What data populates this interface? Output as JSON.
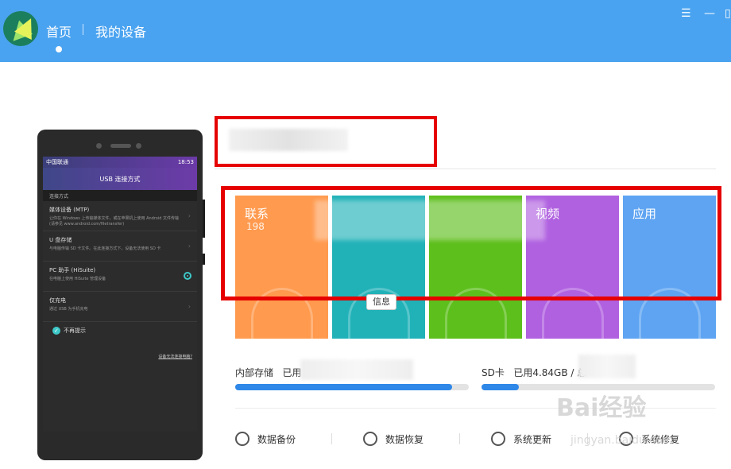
{
  "header": {
    "nav_home": "首页",
    "nav_device": "我的设备",
    "menu_icon": "menu-icon",
    "minimize_icon": "minimize-icon",
    "restore_icon": "restore-icon"
  },
  "phone": {
    "carrier": "中国联通",
    "time": "18:53",
    "title": "USB 连接方式",
    "section": "连接方式",
    "options": [
      {
        "title": "媒体设备 (MTP)",
        "desc": "让你在 Windows 上传输媒体文件，或在苹果机上使用 Android 文件传输 (请参见 www.android.com/filetransfer)"
      },
      {
        "title": "U 盘存储",
        "desc": "与电脑传输 SD 卡文件。在此连接方式下，设备无法使用 SD 卡"
      },
      {
        "title": "PC 助手 (HiSuite)",
        "desc": "在电脑上使用 HiSuite 管理设备",
        "selected": true
      },
      {
        "title": "仅充电",
        "desc": "通过 USB 为手机充电"
      }
    ],
    "noshow": "不再提示",
    "help_link": "设备无法连接电脑?"
  },
  "tiles": [
    {
      "label": "联系",
      "count": "198",
      "color": "#ff9a4e"
    },
    {
      "label": "",
      "count": "",
      "color": "#21b2b8"
    },
    {
      "label": "",
      "count": "",
      "color": "#5dbf1c"
    },
    {
      "label": "视频",
      "count": "",
      "color": "#b061e0"
    },
    {
      "label": "应用",
      "count": "",
      "color": "#5ea4f2"
    }
  ],
  "tooltip": "信息",
  "storage": {
    "internal_label": "内部存储",
    "internal_used_prefix": "已用",
    "internal_fill_percent": 0.93,
    "sd_label": "SD卡",
    "sd_used_text": "已用4.84GB / 总",
    "sd_fill_percent": 0.16
  },
  "tools": [
    {
      "label": "数据备份",
      "icon": "backup-icon"
    },
    {
      "label": "数据恢复",
      "icon": "restore-data-icon"
    },
    {
      "label": "系统更新",
      "icon": "update-icon"
    },
    {
      "label": "系统修复",
      "icon": "repair-icon"
    }
  ],
  "watermark": {
    "main": "Bai经验",
    "sub": "jingyan.baidu.com"
  }
}
